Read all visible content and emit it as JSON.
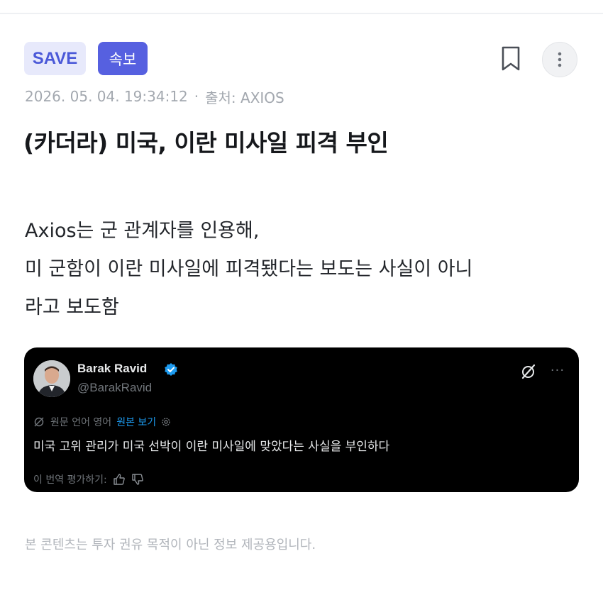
{
  "header": {
    "save_badge": "SAVE",
    "breaking_badge": "속보",
    "icons": {
      "bookmark": "bookmark-icon",
      "more": "more-vertical-icon"
    }
  },
  "article": {
    "timestamp": "2026. 05. 04. 19:34:12",
    "separator": "·",
    "source": "출처: AXIOS",
    "title": "(카더라) 미국, 이란 미사일 피격 부인",
    "body_lines": [
      "Axios는 군 관계자를 인용해,",
      "미 군함이 이란 미사일에 피격됐다는 보도는 사실이 아니",
      "라고 보도함"
    ]
  },
  "tweet": {
    "author_name": "Barak Ravid",
    "handle": "@BarakRavid",
    "translation_label": "원문 언어 영어",
    "view_original": "원본 보기",
    "translated_text": "미국 고위 관리가 미국 선박이 이란 미사일에 맞았다는 사실을 부인하다",
    "rate_label": "이 번역 평가하기:",
    "icons": {
      "verified": "verified-badge-icon",
      "grok": "grok-icon",
      "more": "more-horizontal-icon",
      "translate": "translate-icon",
      "settings": "gear-icon",
      "thumbs_up": "thumbs-up-icon",
      "thumbs_down": "thumbs-down-icon"
    },
    "colors": {
      "background": "#000000",
      "link": "#1d9bf0",
      "verified": "#1d9bf0"
    }
  },
  "footer": {
    "disclaimer": "본 콘텐츠는 투자 권유 목적이 아닌 정보 제공용입니다."
  },
  "colors": {
    "accent": "#5660e0",
    "save_badge_bg": "#e7e9fb",
    "save_badge_text": "#4b59d8"
  }
}
